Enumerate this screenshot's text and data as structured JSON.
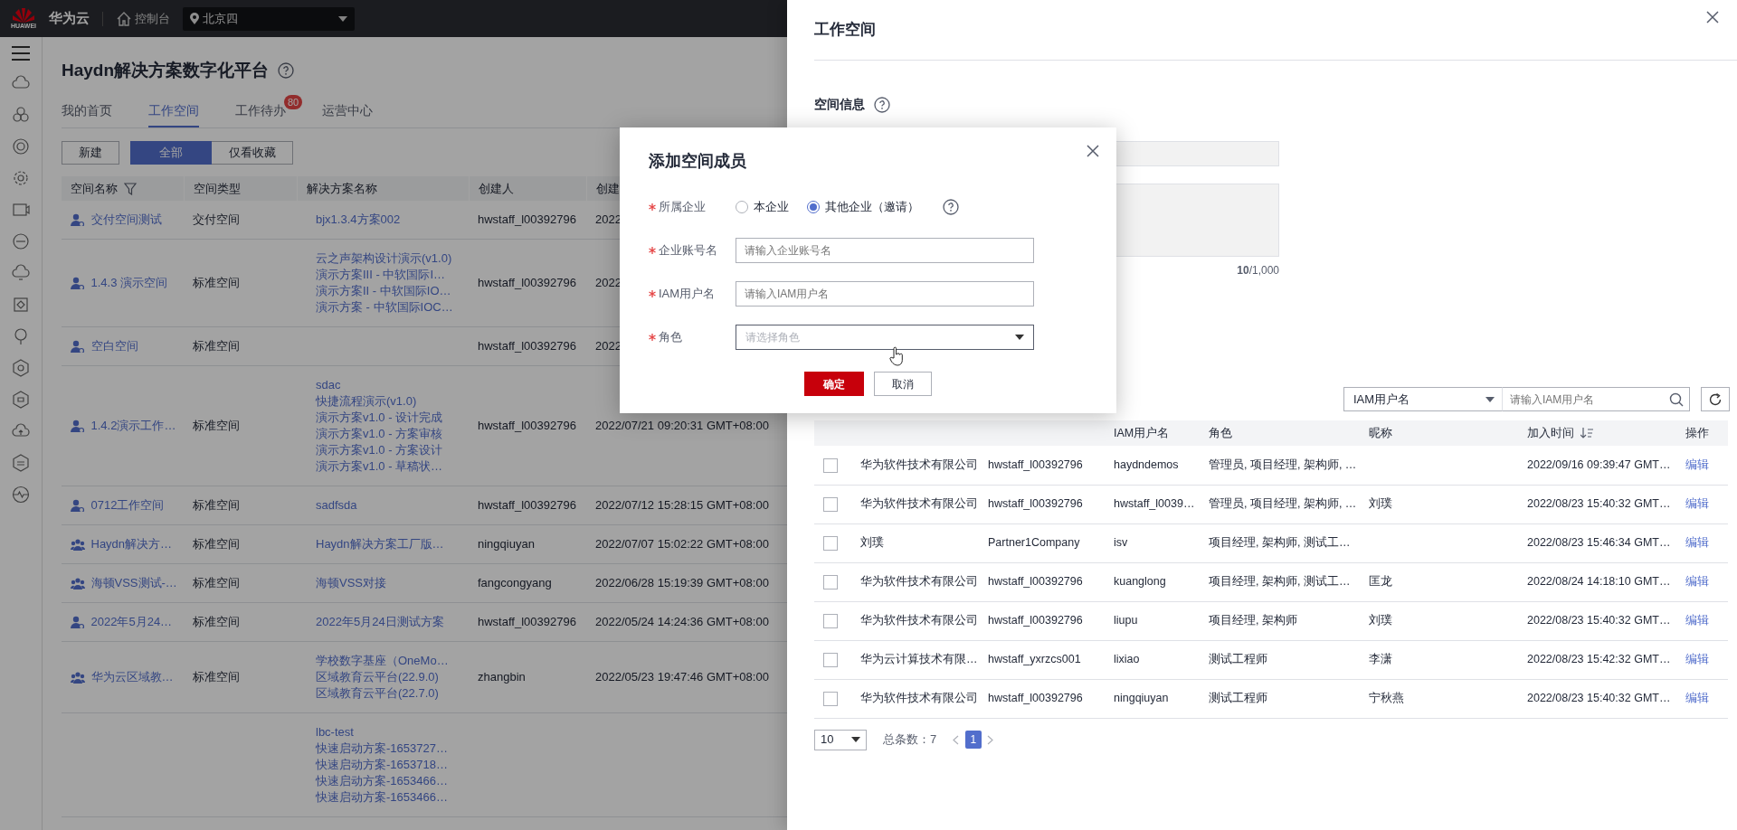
{
  "top_bar": {
    "logo_text": "HUAWEI",
    "brand": "华为云",
    "console": "控制台",
    "region": "北京四"
  },
  "page": {
    "title": "Haydn解决方案数字化平台",
    "tabs": [
      {
        "label": "我的首页",
        "selected": false
      },
      {
        "label": "工作空间",
        "selected": true
      },
      {
        "label": "工作待办",
        "selected": false,
        "badge": "80"
      },
      {
        "label": "运营中心",
        "selected": false
      }
    ],
    "new_button": "新建",
    "filters": [
      {
        "label": "全部",
        "selected": true
      },
      {
        "label": "仅看收藏",
        "selected": false
      }
    ],
    "table": {
      "columns": [
        {
          "label": "空间名称",
          "filter": true
        },
        {
          "label": "空间类型",
          "filter": false
        },
        {
          "label": "解决方案名称",
          "filter": false
        },
        {
          "label": "创建人",
          "filter": false
        },
        {
          "label": "创建",
          "filter": false
        }
      ],
      "rows": [
        {
          "kind": "single",
          "name": "交付空间测试",
          "type": "交付空间",
          "solutions": [
            "bjx1.3.4方案002"
          ],
          "creator": "hwstaff_l00392796",
          "created": "2022"
        },
        {
          "kind": "single",
          "name": "1.4.3 演示空间",
          "type": "标准空间",
          "solutions": [
            "云之声架构设计演示(v1.0)",
            "演示方案III - 中软国际I…",
            "演示方案II - 中软国际IO…",
            "演示方案 - 中软国际IOC…"
          ],
          "creator": "hwstaff_l00392796",
          "created": "2022"
        },
        {
          "kind": "single",
          "name": "空白空间",
          "type": "标准空间",
          "solutions": [],
          "creator": "hwstaff_l00392796",
          "created": "2022"
        },
        {
          "kind": "single",
          "name": "1.4.2演示工作…",
          "type": "标准空间",
          "solutions": [
            "sdac",
            "快捷流程演示(v1.0)",
            "演示方案v1.0 - 设计完成",
            "演示方案v1.0 - 方案审核",
            "演示方案v1.0 - 方案设计",
            "演示方案v1.0 - 草稿状…"
          ],
          "creator": "hwstaff_l00392796",
          "created": "2022/07/21 09:20:31 GMT+08:00"
        },
        {
          "kind": "single",
          "name": "0712工作空间",
          "type": "标准空间",
          "solutions": [
            "sadfsda"
          ],
          "creator": "hwstaff_l00392796",
          "created": "2022/07/12 15:28:15 GMT+08:00"
        },
        {
          "kind": "team",
          "name": "Haydn解决方…",
          "type": "标准空间",
          "solutions": [
            "Haydn解决方案工厂版…"
          ],
          "creator": "ningqiuyan",
          "created": "2022/07/07 15:02:22 GMT+08:00"
        },
        {
          "kind": "team",
          "name": "海顿VSS测试-…",
          "type": "标准空间",
          "solutions": [
            "海顿VSS对接"
          ],
          "creator": "fangcongyang",
          "created": "2022/06/28 15:19:39 GMT+08:00"
        },
        {
          "kind": "single",
          "name": "2022年5月24…",
          "type": "标准空间",
          "solutions": [
            "2022年5月24日测试方案"
          ],
          "creator": "hwstaff_l00392796",
          "created": "2022/05/24 14:24:36 GMT+08:00"
        },
        {
          "kind": "team",
          "name": "华为云区域教…",
          "type": "标准空间",
          "solutions": [
            "学校数字基座（OneMo…",
            "区域教育云平台(22.9.0)",
            "区域教育云平台(22.7.0)"
          ],
          "creator": "zhangbin",
          "created": "2022/05/23 19:47:46 GMT+08:00"
        },
        {
          "solutions": [
            "lbc-test",
            "快速启动方案-1653727…",
            "快速启动方案-1653718…",
            "快速启动方案-1653466…",
            "快速启动方案-1653466…"
          ]
        }
      ]
    }
  },
  "drawer": {
    "title": "工作空间",
    "section": "空间信息",
    "counter": "**10**/1,000",
    "search": {
      "field": "IAM用户名",
      "placeholder": "请输入IAM用户名"
    },
    "table": {
      "columns": [
        {
          "label": "IAM用户名",
          "sortable": false
        },
        {
          "label": "角色",
          "sortable": false
        },
        {
          "label": "昵称",
          "sortable": false
        },
        {
          "label": "加入时间",
          "sortable": true
        },
        {
          "label": "操作",
          "sortable": false
        }
      ],
      "rows": [
        {
          "checked": false,
          "company": "华为软件技术有限公司",
          "account": "hwstaff_l00392796",
          "iam_user": "haydndemos",
          "roles": "管理员, 项目经理, 架构师, …",
          "joined": "2022/09/16 09:39:47 GMT…",
          "action": "编辑"
        },
        {
          "checked": false,
          "company": "华为软件技术有限公司",
          "account": "hwstaff_l00392796",
          "iam_user": "hwstaff_l0039…",
          "roles": "管理员, 项目经理, 架构师, …",
          "nickname": "刘璞",
          "joined": "2022/08/23 15:40:32 GMT…",
          "action": "编辑"
        },
        {
          "checked": false,
          "company": "刘璞",
          "account": "Partner1Company",
          "iam_user": "isv",
          "roles": "项目经理, 架构师, 测试工…",
          "joined": "2022/08/23 15:46:34 GMT…",
          "action": "编辑"
        },
        {
          "checked": false,
          "company": "华为软件技术有限公司",
          "account": "hwstaff_l00392796",
          "iam_user": "kuanglong",
          "roles": "项目经理, 架构师, 测试工…",
          "nickname": "匡龙",
          "joined": "2022/08/24 14:18:10 GMT…",
          "action": "编辑"
        },
        {
          "checked": false,
          "company": "华为软件技术有限公司",
          "account": "hwstaff_l00392796",
          "iam_user": "liupu",
          "roles": "项目经理, 架构师",
          "nickname": "刘璞",
          "joined": "2022/08/23 15:40:32 GMT…",
          "action": "编辑"
        },
        {
          "checked": false,
          "company": "华为云计算技术有限…",
          "account": "hwstaff_yxrzcs001",
          "iam_user": "lixiao",
          "roles": "测试工程师",
          "nickname": "李潇",
          "joined": "2022/08/23 15:42:32 GMT…",
          "action": "编辑"
        },
        {
          "checked": false,
          "company": "华为软件技术有限公司",
          "account": "hwstaff_l00392796",
          "iam_user": "ningqiuyan",
          "roles": "测试工程师",
          "nickname": "宁秋燕",
          "joined": "2022/08/23 15:40:32 GMT…",
          "action": "编辑"
        }
      ]
    },
    "pagination": {
      "page_size": "10",
      "total": "总条数：7",
      "pages": [
        {
          "label": "1",
          "selected": true
        }
      ]
    }
  },
  "modal": {
    "title": "添加空间成员",
    "fields": [
      {
        "kind": "radio",
        "label": "所属企业",
        "required": true,
        "options": [
          {
            "label": "本企业",
            "selected": false
          },
          {
            "label": "其他企业（邀请）",
            "selected": true
          }
        ]
      },
      {
        "kind": "input",
        "label": "企业账号名",
        "required": true,
        "placeholder": "请输入企业账号名"
      },
      {
        "kind": "input",
        "label": "IAM用户名",
        "required": true,
        "placeholder": "请输入IAM用户名"
      },
      {
        "kind": "select",
        "label": "角色",
        "required": true,
        "placeholder": "请选择角色"
      }
    ],
    "buttons": [
      {
        "label": "确定",
        "kind": "primary"
      },
      {
        "label": "取消",
        "kind": "secondary"
      }
    ]
  }
}
